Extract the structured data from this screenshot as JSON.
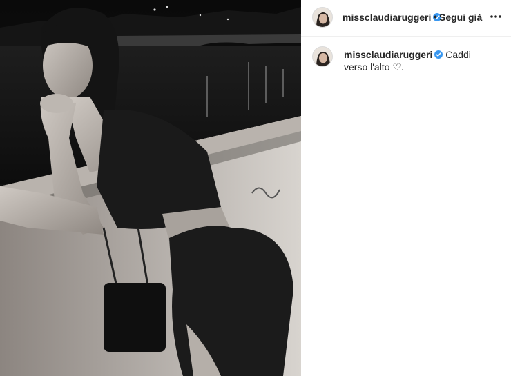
{
  "post": {
    "username": "missclaudiaruggeri",
    "verified_icon": "verified-badge-icon",
    "separator": "•",
    "follow_label": "Segui già",
    "more_icon": "more-options-icon",
    "caption_text": "Caddi verso l'alto ♡."
  },
  "colors": {
    "verified": "#3897f0",
    "text": "#262626",
    "border": "#efefef"
  }
}
